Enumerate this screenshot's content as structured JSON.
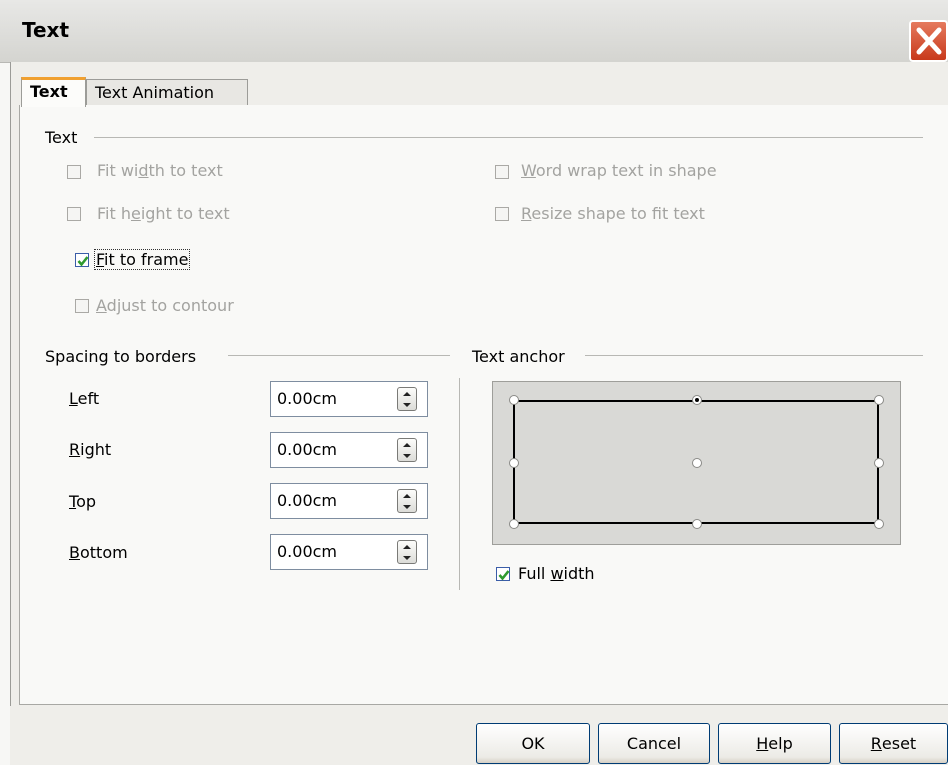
{
  "window": {
    "title": "Text"
  },
  "tabs": [
    {
      "label": "Text"
    },
    {
      "label": "Text Animation"
    }
  ],
  "text_section": {
    "title": "Text",
    "options": [
      {
        "label_pre": "Fit wi",
        "mnemonic": "d",
        "label_post": "th to text",
        "checked": false,
        "enabled": false
      },
      {
        "label_pre": "Fit h",
        "mnemonic": "e",
        "label_post": "ight to text",
        "checked": false,
        "enabled": false
      },
      {
        "label_pre": "",
        "mnemonic": "F",
        "label_post": "it to frame",
        "checked": true,
        "enabled": true
      },
      {
        "label_pre": "",
        "mnemonic": "A",
        "label_post": "djust to contour",
        "checked": false,
        "enabled": false
      },
      {
        "label_pre": "",
        "mnemonic": "W",
        "label_post": "ord wrap text in shape",
        "checked": false,
        "enabled": false
      },
      {
        "label_pre": "",
        "mnemonic": "R",
        "label_post": "esize shape to fit text",
        "checked": false,
        "enabled": false
      }
    ]
  },
  "spacing": {
    "title": "Spacing to borders",
    "fields": [
      {
        "mnemonic": "L",
        "label_post": "eft",
        "value": "0.00cm"
      },
      {
        "mnemonic": "R",
        "label_post": "ight",
        "value": "0.00cm"
      },
      {
        "mnemonic": "T",
        "label_post": "op",
        "value": "0.00cm"
      },
      {
        "mnemonic": "B",
        "label_post": "ottom",
        "value": "0.00cm"
      }
    ]
  },
  "anchor": {
    "title": "Text anchor",
    "selected": "top-center",
    "full_width": {
      "label_pre": "Full ",
      "mnemonic": "w",
      "label_post": "idth",
      "checked": true
    }
  },
  "buttons": {
    "ok": "OK",
    "cancel": "Cancel",
    "help_mnemonic": "H",
    "help_rest": "elp",
    "reset_mnemonic": "R",
    "reset_rest": "eset"
  },
  "colors": {
    "check_accent": "#2f9a2f",
    "active_tab_accent": "#f0a030",
    "close_button": "#d04a2a"
  }
}
